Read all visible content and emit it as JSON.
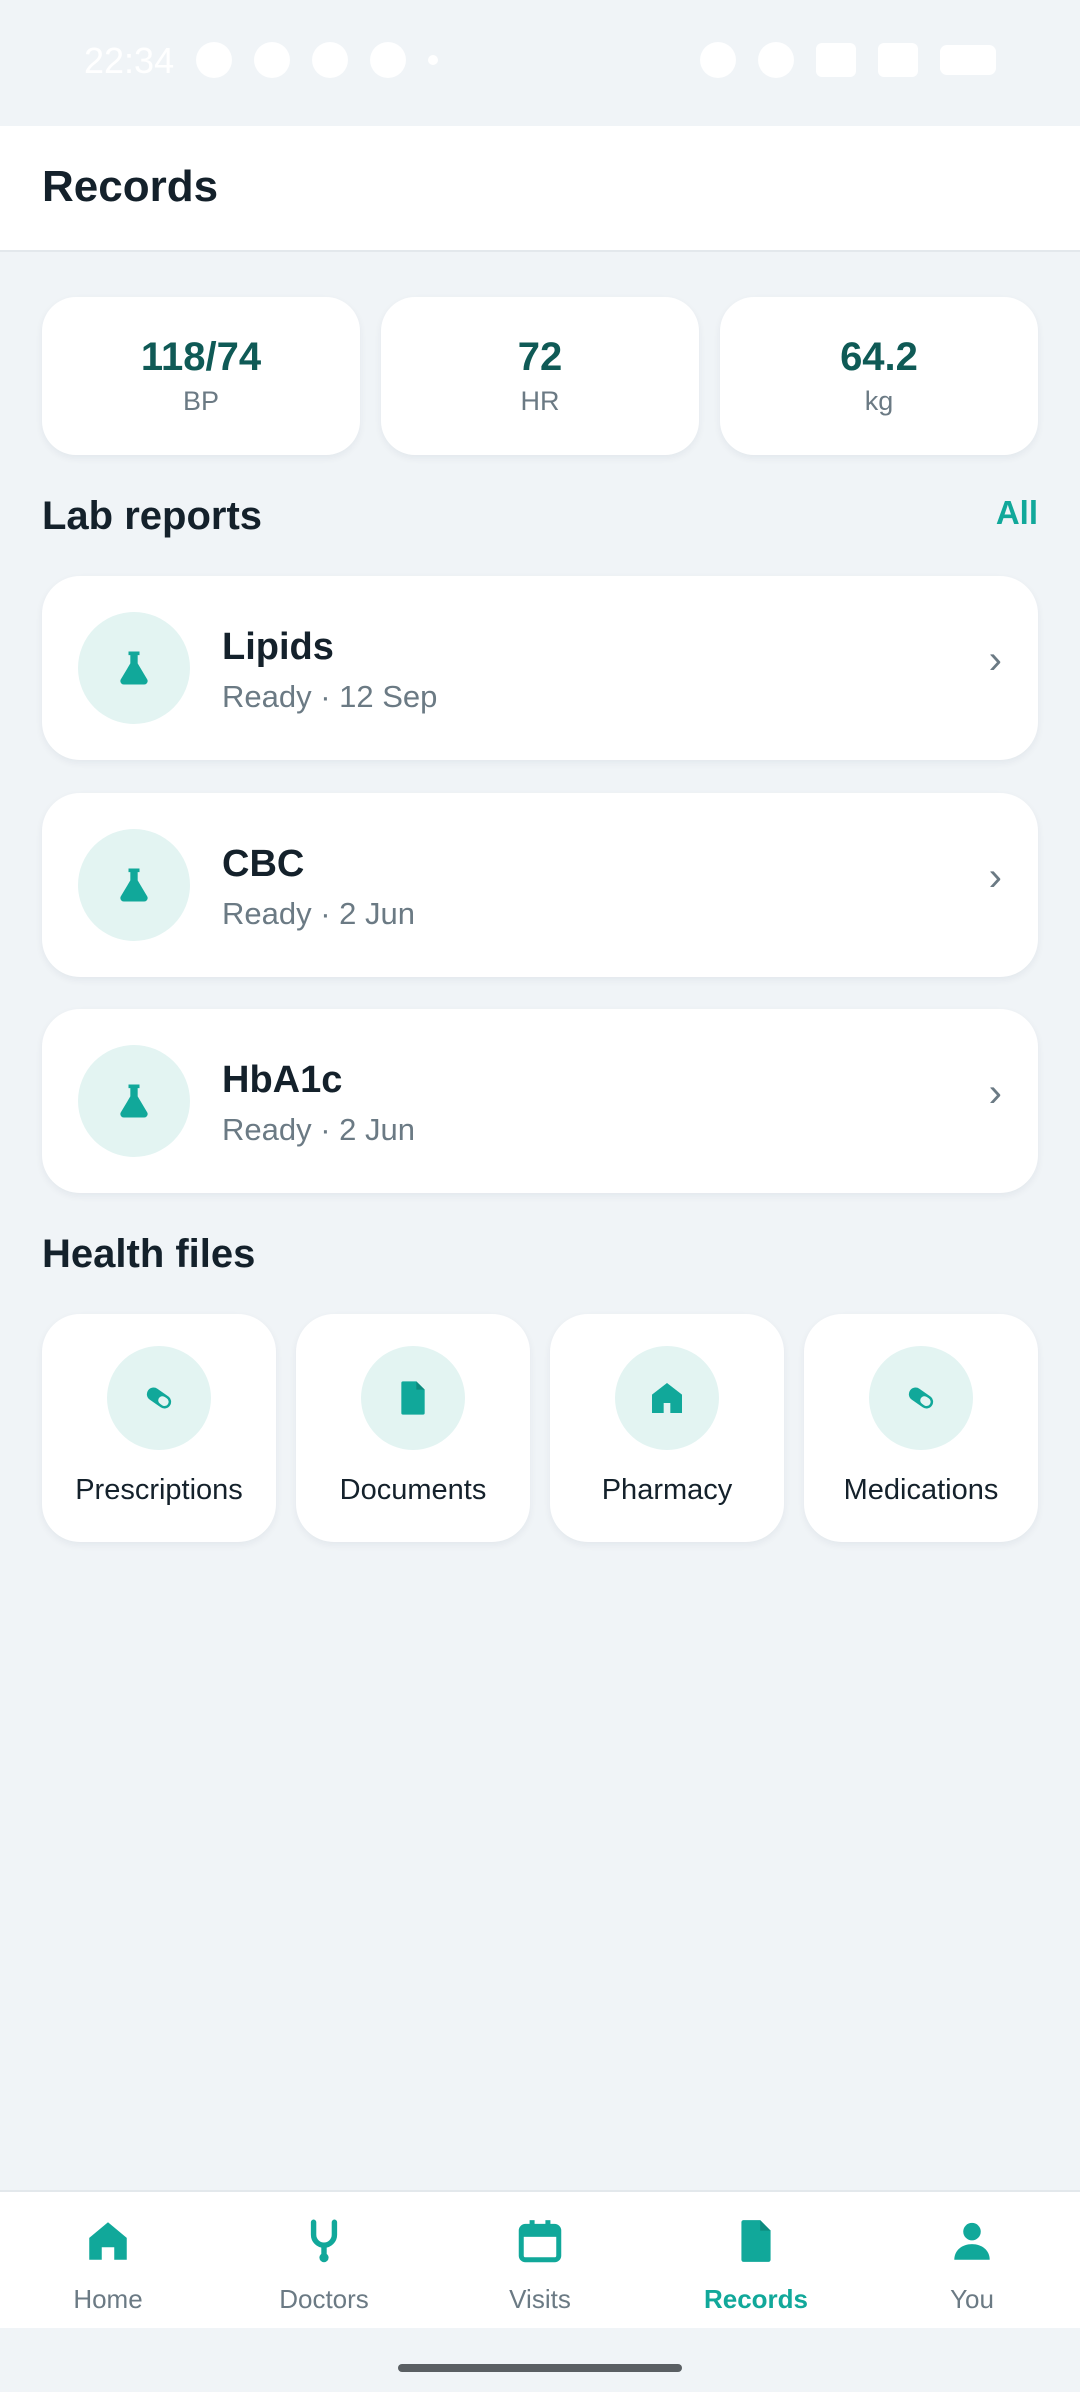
{
  "status_bar": {
    "time": "22:34"
  },
  "app_bar": {
    "title": "Records"
  },
  "vitals": [
    {
      "value": "118/74",
      "label": "BP"
    },
    {
      "value": "72",
      "label": "HR"
    },
    {
      "value": "64.2",
      "label": "kg"
    }
  ],
  "lab_reports": {
    "title": "Lab reports",
    "link_label": "All",
    "items": [
      {
        "name": "Lipids",
        "meta": "Ready · 12 Sep",
        "icon": "flask-icon"
      },
      {
        "name": "CBC",
        "meta": "Ready · 2 Jun",
        "icon": "flask-icon"
      },
      {
        "name": "HbA1c",
        "meta": "Ready · 2 Jun",
        "icon": "flask-icon"
      }
    ]
  },
  "health_files": {
    "title": "Health files",
    "items": [
      {
        "label": "Prescriptions",
        "icon": "pill-icon"
      },
      {
        "label": "Documents",
        "icon": "document-icon"
      },
      {
        "label": "Pharmacy",
        "icon": "store-icon"
      },
      {
        "label": "Medications",
        "icon": "pill-icon"
      }
    ]
  },
  "bottom_nav": {
    "active": "Records",
    "items": [
      {
        "label": "Home",
        "icon": "home-icon"
      },
      {
        "label": "Doctors",
        "icon": "stethoscope-icon"
      },
      {
        "label": "Visits",
        "icon": "calendar-icon"
      },
      {
        "label": "Records",
        "icon": "document-icon"
      },
      {
        "label": "You",
        "icon": "person-icon"
      }
    ]
  },
  "colors": {
    "accent": "#11a89a",
    "accent_dark": "#0f5a56",
    "icon_bg": "#e3f4f2",
    "background": "#f0f4f7",
    "text": "#14212b",
    "muted": "#6b7a84"
  }
}
